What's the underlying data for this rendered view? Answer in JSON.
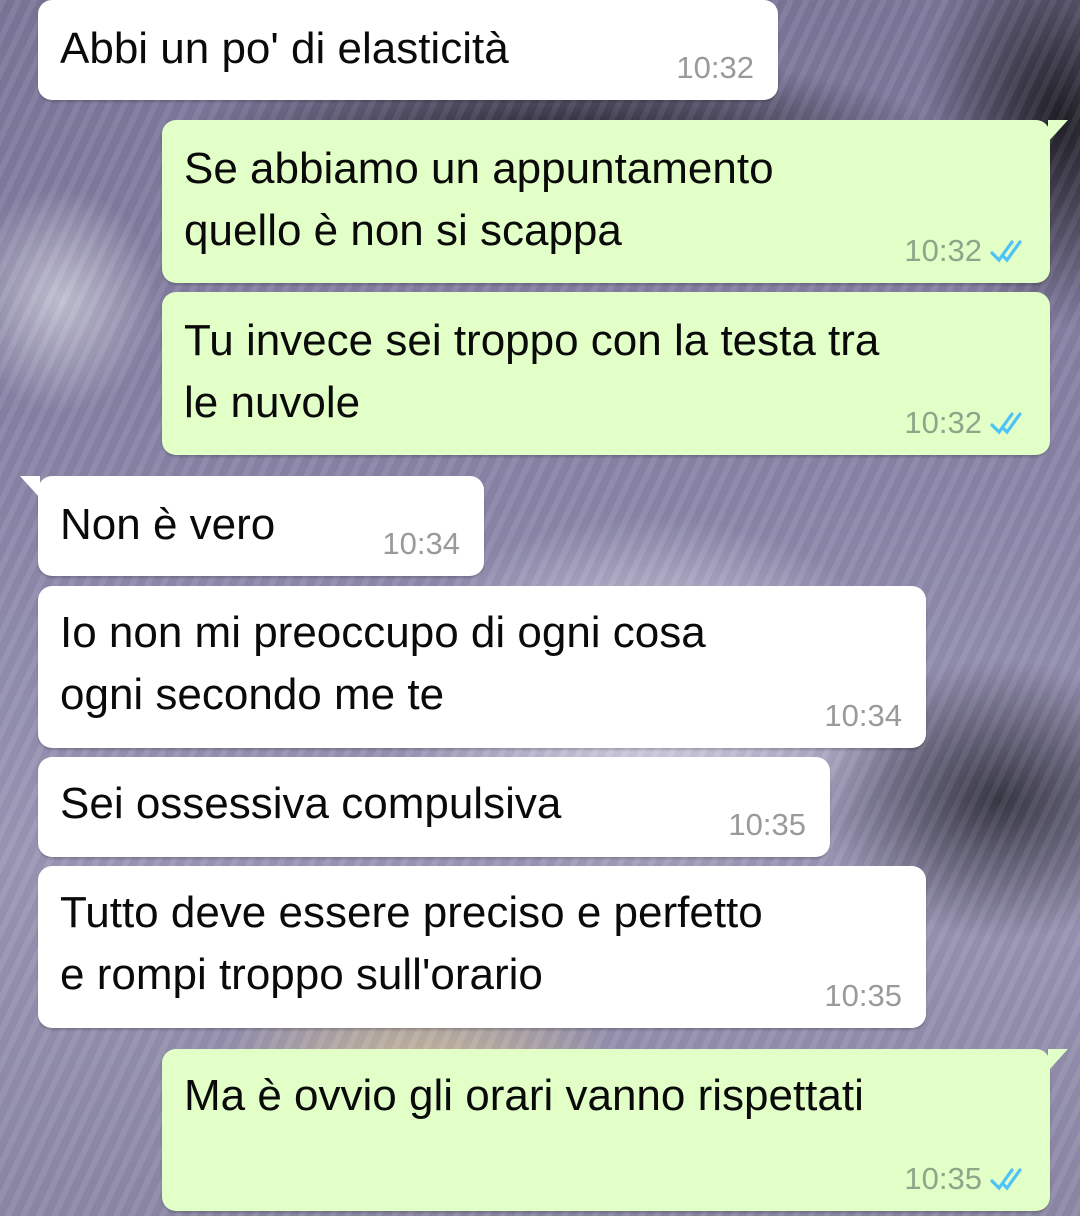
{
  "colors": {
    "incoming_bubble": "#ffffff",
    "outgoing_bubble": "#e1ffc7",
    "read_ticks": "#4fc3f7"
  },
  "messages": [
    {
      "direction": "incoming",
      "text_lines": [
        "Abbi un po' di elasticità"
      ],
      "time": "10:32"
    },
    {
      "direction": "outgoing",
      "text_lines": [
        "Se abbiamo un appuntamento",
        "quello è non si scappa"
      ],
      "time": "10:32",
      "status_icon": "double-check-icon"
    },
    {
      "direction": "outgoing",
      "text_lines": [
        "Tu invece sei troppo con la testa tra",
        "le nuvole"
      ],
      "time": "10:32",
      "status_icon": "double-check-icon"
    },
    {
      "direction": "incoming",
      "text_lines": [
        "Non è vero"
      ],
      "time": "10:34"
    },
    {
      "direction": "incoming",
      "text_lines": [
        "Io non mi preoccupo di ogni cosa",
        "ogni secondo me te"
      ],
      "time": "10:34"
    },
    {
      "direction": "incoming",
      "text_lines": [
        "Sei ossessiva compulsiva"
      ],
      "time": "10:35"
    },
    {
      "direction": "incoming",
      "text_lines": [
        "Tutto deve essere preciso e perfetto",
        "e rompi troppo sull'orario"
      ],
      "time": "10:35"
    },
    {
      "direction": "outgoing",
      "text_lines": [
        "Ma è ovvio gli orari vanno rispettati"
      ],
      "time": "10:35",
      "status_icon": "double-check-icon"
    }
  ]
}
